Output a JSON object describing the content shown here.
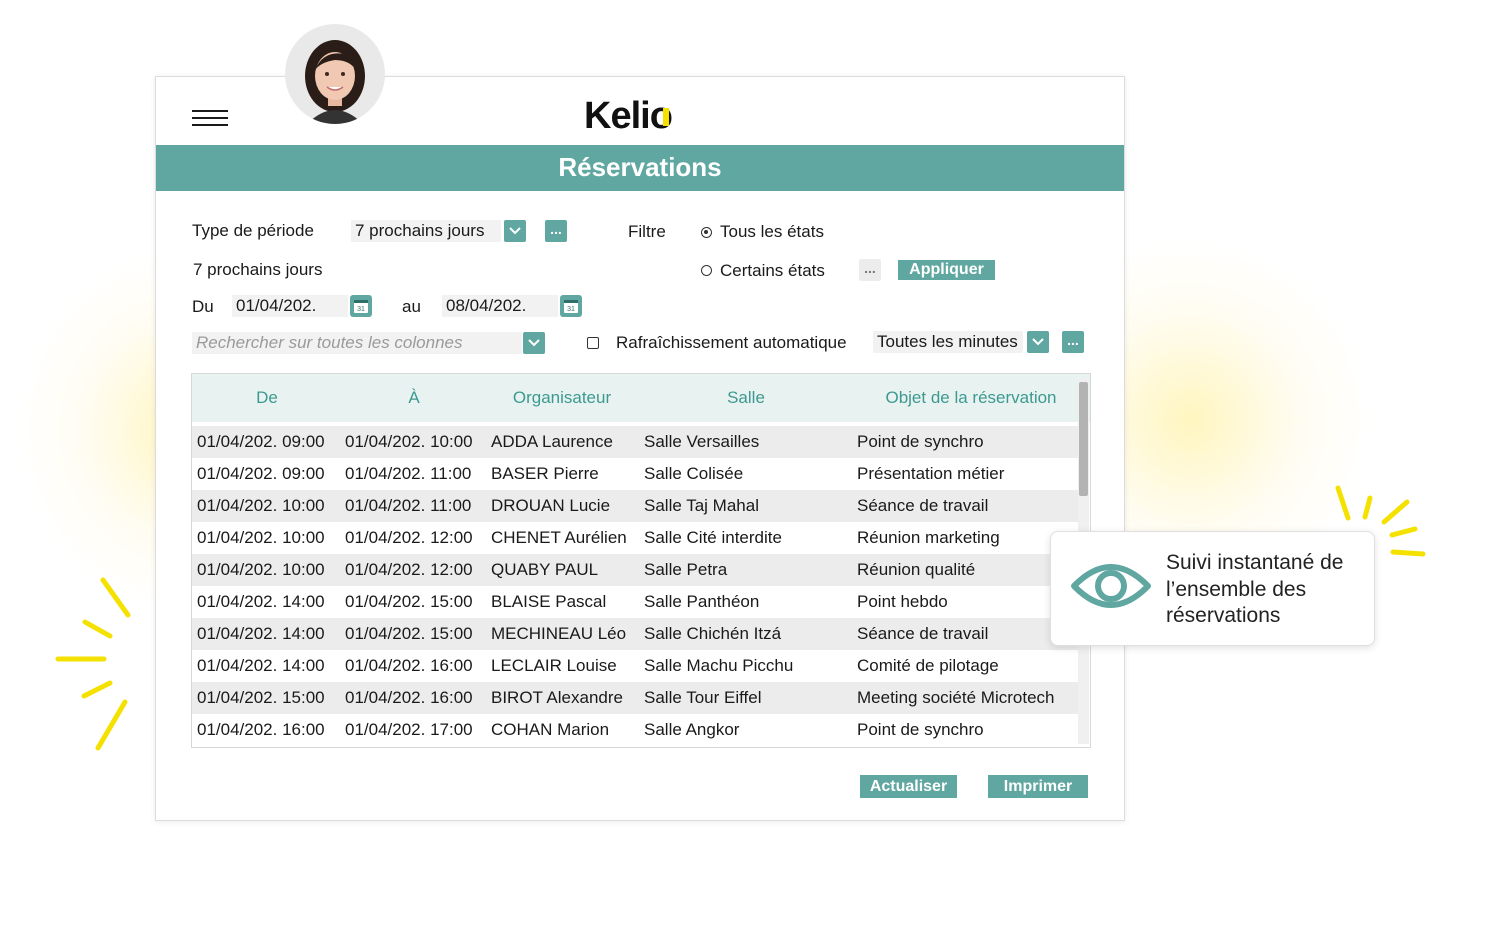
{
  "app": {
    "logo": "Kelio"
  },
  "window": {
    "title": "Réservations"
  },
  "filters": {
    "period_type_label": "Type de période",
    "period_type_value": "7 prochains jours",
    "period_summary": "7 prochains jours",
    "filter_label": "Filtre",
    "radio_all_label": "Tous les états",
    "radio_some_label": "Certains états",
    "apply_label": "Appliquer",
    "from_label": "Du",
    "from_value": "01/04/202.",
    "to_label": "au",
    "to_value": "08/04/202.",
    "search_placeholder": "Rechercher sur toutes les colonnes",
    "auto_refresh_label": "Rafraîchissement automatique",
    "auto_refresh_checked": false,
    "refresh_interval_value": "Toutes les minutes",
    "more_label": "..."
  },
  "table": {
    "columns": [
      "De",
      "À",
      "Organisateur",
      "Salle",
      "Objet de la réservation"
    ],
    "rows": [
      [
        "01/04/202. 09:00",
        "01/04/202. 10:00",
        "ADDA Laurence",
        "Salle Versailles",
        "Point de synchro"
      ],
      [
        "01/04/202. 09:00",
        "01/04/202. 11:00",
        "BASER Pierre",
        "Salle Colisée",
        "Présentation métier"
      ],
      [
        "01/04/202. 10:00",
        "01/04/202. 11:00",
        "DROUAN Lucie",
        "Salle Taj Mahal",
        "Séance de travail"
      ],
      [
        "01/04/202. 10:00",
        "01/04/202. 12:00",
        "CHENET Aurélien",
        "Salle Cité interdite",
        "Réunion marketing"
      ],
      [
        "01/04/202. 10:00",
        "01/04/202. 12:00",
        "QUABY PAUL",
        "Salle Petra",
        "Réunion qualité"
      ],
      [
        "01/04/202. 14:00",
        "01/04/202. 15:00",
        "BLAISE Pascal",
        "Salle Panthéon",
        "Point hebdo"
      ],
      [
        "01/04/202. 14:00",
        "01/04/202. 15:00",
        "MECHINEAU Léo",
        "Salle Chichén Itzá",
        "Séance de travail"
      ],
      [
        "01/04/202. 14:00",
        "01/04/202. 16:00",
        "LECLAIR Louise",
        "Salle Machu Picchu",
        "Comité de pilotage"
      ],
      [
        "01/04/202. 15:00",
        "01/04/202. 16:00",
        "BIROT Alexandre",
        "Salle Tour Eiffel",
        "Meeting société Microtech"
      ],
      [
        "01/04/202. 16:00",
        "01/04/202. 17:00",
        "COHAN Marion",
        "Salle Angkor",
        "Point de synchro"
      ]
    ]
  },
  "actions": {
    "refresh_label": "Actualiser",
    "print_label": "Imprimer"
  },
  "callout": {
    "text": "Suivi instantané de l’ensemble des réservations"
  },
  "icons": {
    "menu": "hamburger-icon",
    "dropdown": "chevron-down-icon",
    "calendar": "calendar-icon",
    "eye": "eye-icon",
    "avatar": "user-avatar"
  },
  "colors": {
    "accent": "#5fa7a0",
    "header_text": "#3d9990",
    "highlight": "#f5e100",
    "row_alt": "#ececec"
  }
}
